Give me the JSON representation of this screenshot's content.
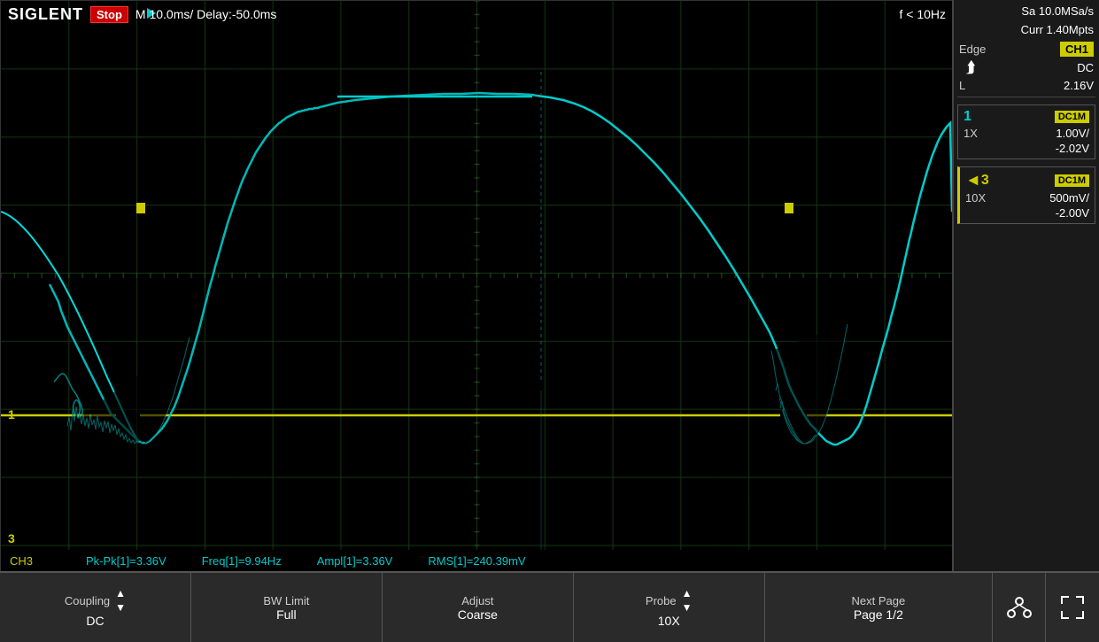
{
  "header": {
    "logo": "SIGLENT",
    "stop_label": "Stop",
    "timebase": "M 10.0ms/ Delay:-50.0ms",
    "freq_label": "f < 10Hz"
  },
  "sample": {
    "sa_label": "Sa 10.0MSa/s",
    "curr_label": "Curr 1.40Mpts"
  },
  "trigger": {
    "edge_label": "Edge",
    "ch1_label": "CH1",
    "dc_label": "DC",
    "level_label": "L",
    "level_value": "2.16V"
  },
  "channel1": {
    "num": "1",
    "coupling": "DC1M",
    "probe": "1X",
    "vdiv": "1.00V/",
    "offset": "-2.02V"
  },
  "channel3": {
    "num": "3",
    "coupling": "DC1M",
    "probe": "10X",
    "vdiv": "500mV/",
    "offset": "-2.00V"
  },
  "measurements": {
    "ch_label": "CH3",
    "pk_pk_label": "Pk-Pk[1]=",
    "pk_pk_value": "3.36V",
    "freq_label": "Freq[1]=",
    "freq_value": "9.94Hz",
    "ampl_label": "Ampl[1]=",
    "ampl_value": "3.36V",
    "rms_label": "RMS[1]=",
    "rms_value": "240.39mV"
  },
  "bottom_bar": {
    "coupling_label": "Coupling",
    "coupling_value": "DC",
    "bw_label": "BW Limit",
    "bw_value": "Full",
    "adjust_label": "Adjust",
    "adjust_value": "Coarse",
    "probe_label": "Probe",
    "probe_value": "10X",
    "next_page_label": "Next Page",
    "next_page_value": "Page 1/2"
  },
  "colors": {
    "cyan": "#00cccc",
    "yellow": "#cccc00",
    "grid": "#1a3a1a",
    "bg": "#000000",
    "panel_bg": "#1a1a1a"
  }
}
